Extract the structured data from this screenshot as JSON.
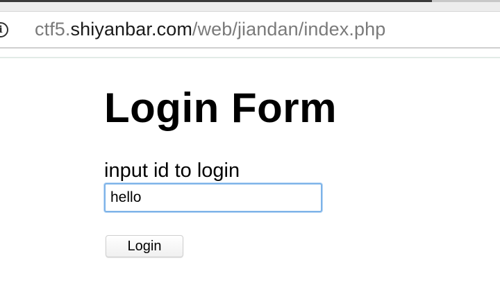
{
  "browser": {
    "url_prefix": "ctf5.",
    "url_domain": "shiyanbar.com",
    "url_path": "/web/jiandan/index.php",
    "info_icon": "info-icon"
  },
  "page": {
    "title": "Login Form",
    "prompt": "input id to login",
    "input_value": "hello",
    "button_label": "Login"
  },
  "colors": {
    "input_focus_border": "#7db3e8",
    "url_secondary": "#7a7a7a",
    "url_primary": "#1a1a1a"
  }
}
